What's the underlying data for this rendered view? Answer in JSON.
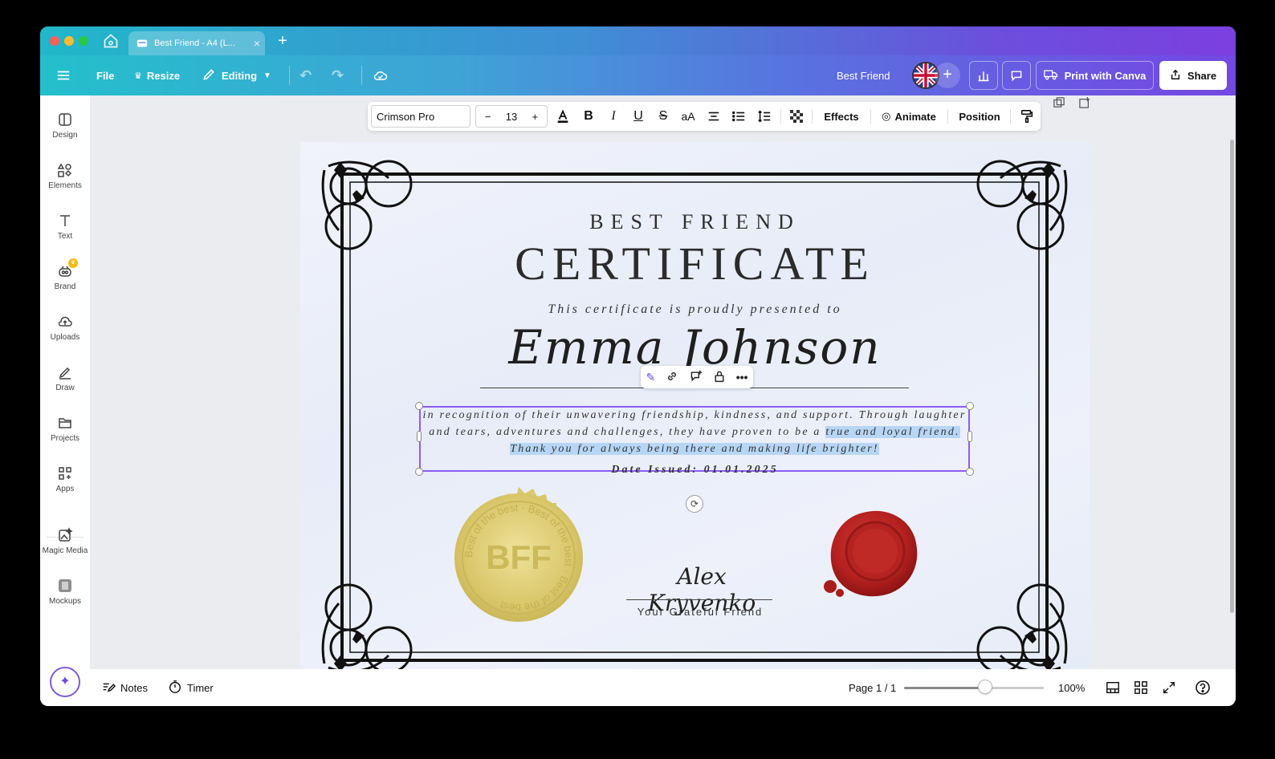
{
  "tab": {
    "title": "Best Friend - A4 (L...",
    "close": "×",
    "new_tab": "+"
  },
  "header": {
    "file_label": "File",
    "resize_label": "Resize",
    "editing_label": "Editing",
    "doc_name": "Best Friend",
    "print_label": "Print with Canva",
    "share_label": "Share"
  },
  "sidebar": {
    "items": [
      {
        "label": "Design",
        "icon": "design-icon"
      },
      {
        "label": "Elements",
        "icon": "elements-icon"
      },
      {
        "label": "Text",
        "icon": "text-icon"
      },
      {
        "label": "Brand",
        "icon": "brand-icon"
      },
      {
        "label": "Uploads",
        "icon": "uploads-icon"
      },
      {
        "label": "Draw",
        "icon": "draw-icon"
      },
      {
        "label": "Projects",
        "icon": "projects-icon"
      },
      {
        "label": "Apps",
        "icon": "apps-icon"
      },
      {
        "label": "Magic Media",
        "icon": "magic-media-icon"
      },
      {
        "label": "Mockups",
        "icon": "mockups-icon"
      }
    ]
  },
  "text_toolbar": {
    "font": "Crimson Pro",
    "minus": "−",
    "size": "13",
    "plus": "+",
    "case_label": "aA",
    "effects_label": "Effects",
    "animate_label": "Animate",
    "position_label": "Position"
  },
  "certificate": {
    "eyebrow": "BEST FRIEND",
    "title": "CERTIFICATE",
    "presented": "This certificate is proudly presented to",
    "name": "Emma Johnson",
    "body_line1": "in recognition of their unwavering friendship, kindness, and support. Through laughter",
    "body_line2_plain": "and tears, adventures and challenges, they have proven to be a ",
    "body_line2_highlight": "true and loyal friend.",
    "body_line3": "Thank you for always being there and making life brighter!",
    "date": "Date Issued: 01.01.2025",
    "seal_text": "BFF",
    "seal_ring": "Best of the best · Best of the best · Best of the best ·",
    "signature": "Alex Kryvenko",
    "signature_caption": "Your Grateful Friend"
  },
  "bottom": {
    "notes_label": "Notes",
    "timer_label": "Timer",
    "page_label": "Page 1 / 1",
    "zoom_label": "100%",
    "zoom_fraction": 0.58
  },
  "colors": {
    "accent": "#8b5cf6",
    "highlight": "#b7d6f5",
    "seal_gold": "#d9c76a",
    "wax_red": "#b3201f"
  }
}
